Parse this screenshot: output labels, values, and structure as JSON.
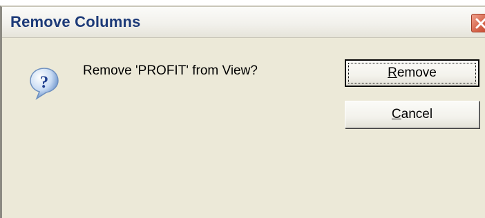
{
  "dialog": {
    "title": "Remove Columns",
    "message": "Remove 'PROFIT' from View?",
    "buttons": {
      "remove": {
        "mnemonic": "R",
        "rest": "emove"
      },
      "cancel": {
        "mnemonic": "C",
        "rest": "ancel"
      }
    },
    "icons": {
      "question": "question-icon",
      "close": "close-icon"
    }
  }
}
